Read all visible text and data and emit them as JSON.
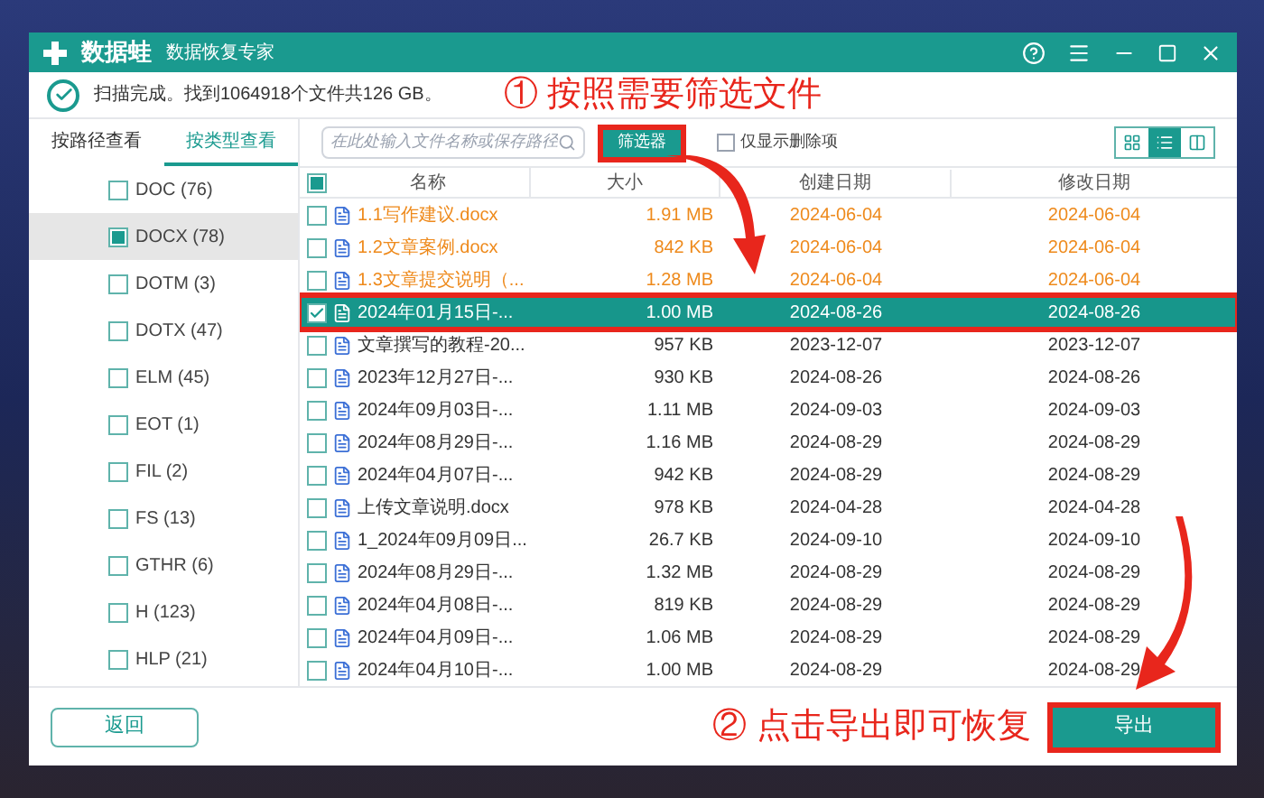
{
  "app": {
    "logo_text": "数据蛙",
    "subtitle": "数据恢复专家"
  },
  "status": {
    "message": "扫描完成。找到1064918个文件共126 GB。",
    "annotation": "① 按照需要筛选文件"
  },
  "left_tabs": [
    {
      "label": "按路径查看",
      "selected": false
    },
    {
      "label": "按类型查看",
      "selected": true
    }
  ],
  "type_list": [
    {
      "label": "DOC (76)",
      "checked": false,
      "selected": false
    },
    {
      "label": "DOCX (78)",
      "checked": true,
      "selected": true
    },
    {
      "label": "DOTM (3)",
      "checked": false,
      "selected": false
    },
    {
      "label": "DOTX (47)",
      "checked": false,
      "selected": false
    },
    {
      "label": "ELM (45)",
      "checked": false,
      "selected": false
    },
    {
      "label": "EOT (1)",
      "checked": false,
      "selected": false
    },
    {
      "label": "FIL (2)",
      "checked": false,
      "selected": false
    },
    {
      "label": "FS (13)",
      "checked": false,
      "selected": false
    },
    {
      "label": "GTHR (6)",
      "checked": false,
      "selected": false
    },
    {
      "label": "H (123)",
      "checked": false,
      "selected": false
    },
    {
      "label": "HLP (21)",
      "checked": false,
      "selected": false
    }
  ],
  "toolbar": {
    "search_placeholder": "在此处输入文件名称或保存路径",
    "filter_button": "筛选器",
    "deleted_only": {
      "label": "仅显示删除项",
      "checked": false
    },
    "view_modes": [
      {
        "kind": "grid",
        "selected": false
      },
      {
        "kind": "list",
        "selected": true
      },
      {
        "kind": "detail",
        "selected": false
      }
    ]
  },
  "table": {
    "select_all": true,
    "columns": [
      "名称",
      "大小",
      "创建日期",
      "修改日期"
    ],
    "rows": [
      {
        "name": "1.1写作建议.docx",
        "size": "1.91 MB",
        "created": "2024-06-04",
        "modified": "2024-06-04",
        "checked": false,
        "selected": false,
        "kind": "highlighted"
      },
      {
        "name": "1.2文章案例.docx",
        "size": "842 KB",
        "created": "2024-06-04",
        "modified": "2024-06-04",
        "checked": false,
        "selected": false,
        "kind": "highlighted"
      },
      {
        "name": "1.3文章提交说明（...",
        "size": "1.28 MB",
        "created": "2024-06-04",
        "modified": "2024-06-04",
        "checked": false,
        "selected": false,
        "kind": "highlighted"
      },
      {
        "name": "2024年01月15日-...",
        "size": "1.00 MB",
        "created": "2024-08-26",
        "modified": "2024-08-26",
        "checked": true,
        "selected": true
      },
      {
        "name": "文章撰写的教程-20...",
        "size": "957 KB",
        "created": "2023-12-07",
        "modified": "2023-12-07",
        "checked": false,
        "selected": false,
        "kind": "normal"
      },
      {
        "name": "2023年12月27日-...",
        "size": "930 KB",
        "created": "2024-08-26",
        "modified": "2024-08-26",
        "checked": false,
        "selected": false,
        "kind": "normal"
      },
      {
        "name": "2024年09月03日-...",
        "size": "1.11 MB",
        "created": "2024-09-03",
        "modified": "2024-09-03",
        "checked": false,
        "selected": false,
        "kind": "normal"
      },
      {
        "name": "2024年08月29日-...",
        "size": "1.16 MB",
        "created": "2024-08-29",
        "modified": "2024-08-29",
        "checked": false,
        "selected": false,
        "kind": "normal"
      },
      {
        "name": "2024年04月07日-...",
        "size": "942 KB",
        "created": "2024-08-29",
        "modified": "2024-08-29",
        "checked": false,
        "selected": false,
        "kind": "normal"
      },
      {
        "name": "上传文章说明.docx",
        "size": "978 KB",
        "created": "2024-04-28",
        "modified": "2024-04-28",
        "checked": false,
        "selected": false,
        "kind": "normal"
      },
      {
        "name": "1_2024年09月09日...",
        "size": "26.7 KB",
        "created": "2024-09-10",
        "modified": "2024-09-10",
        "checked": false,
        "selected": false,
        "kind": "normal"
      },
      {
        "name": "2024年08月29日-...",
        "size": "1.32 MB",
        "created": "2024-08-29",
        "modified": "2024-08-29",
        "checked": false,
        "selected": false,
        "kind": "normal"
      },
      {
        "name": "2024年04月08日-...",
        "size": "819 KB",
        "created": "2024-08-29",
        "modified": "2024-08-29",
        "checked": false,
        "selected": false,
        "kind": "normal"
      },
      {
        "name": "2024年04月09日-...",
        "size": "1.06 MB",
        "created": "2024-08-29",
        "modified": "2024-08-29",
        "checked": false,
        "selected": false,
        "kind": "normal"
      },
      {
        "name": "2024年04月10日-...",
        "size": "1.00 MB",
        "created": "2024-08-29",
        "modified": "2024-08-29",
        "checked": false,
        "selected": false,
        "kind": "normal"
      }
    ]
  },
  "footer": {
    "back_button": "返回",
    "annotation": "② 点击导出即可恢复",
    "export_button": "导出"
  }
}
